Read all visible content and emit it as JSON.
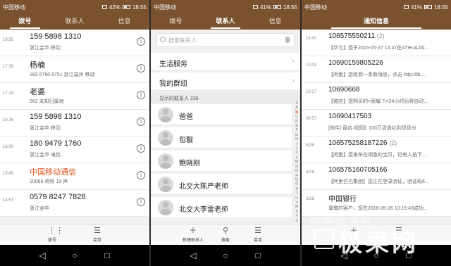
{
  "status": {
    "carrier": "中国移动",
    "battery1": "42%",
    "battery2": "41%",
    "battery3": "41%",
    "time": "18:55"
  },
  "dialer": {
    "tabs": [
      "拨号",
      "联系人",
      "信息"
    ],
    "calls": [
      {
        "time": "18:55",
        "number": "159 5898 1310",
        "sub": "浙江金华 移动",
        "missed": false
      },
      {
        "time": "17:36",
        "number": "杨楠",
        "sub": "183 6780 8751  浙江温州 移动",
        "missed": false
      },
      {
        "time": "17:18",
        "number": "老婆",
        "sub": "662  未知归属地",
        "missed": false
      },
      {
        "time": "16:16",
        "number": "159 5898 1310",
        "sub": "浙江金华 移动",
        "missed": false
      },
      {
        "time": "16:09",
        "number": "180 9479 1760",
        "sub": "浙江金华 电信",
        "missed": false
      },
      {
        "time": "15:45",
        "number": "中国移动通信",
        "sub": "10086  响铃 19 声",
        "missed": true
      },
      {
        "time": "14:57",
        "number": "0579 8247 7828",
        "sub": "浙江金华",
        "missed": false
      }
    ],
    "tools": [
      {
        "label": "拨号"
      },
      {
        "label": "菜单"
      }
    ]
  },
  "contacts": {
    "tabs": [
      "拨号",
      "联系人",
      "信息"
    ],
    "search_placeholder": "搜索联系人",
    "groups": [
      "生活服务",
      "我的群组"
    ],
    "section_label": "显示的联系人 236",
    "names": [
      "爸爸",
      "包靓",
      "鲍晓刚",
      "北交大陈严老师",
      "北交大李雷老师"
    ],
    "alphabet": [
      "#",
      "A",
      "B",
      "C",
      "D",
      "E",
      "F",
      "G",
      "H",
      "I",
      "J",
      "K",
      "L",
      "M",
      "N",
      "O",
      "P",
      "Q",
      "R",
      "S",
      "T",
      "U",
      "V",
      "W",
      "X",
      "Y",
      "Z"
    ],
    "tools": [
      {
        "label": "新建联系人"
      },
      {
        "label": "搜索"
      },
      {
        "label": "菜单"
      }
    ]
  },
  "messages": {
    "title": "通知信息",
    "items": [
      {
        "time": "14:47",
        "sender": "106575550211",
        "count": "(2)",
        "preview": "【华为】您于2016-05-27 14:47在ATH-AL00..."
      },
      {
        "time": "13:01",
        "sender": "10690159805226",
        "count": "",
        "preview": "【闲鱼】您收到一条新消息，点击 http://tb...."
      },
      {
        "time": "10:27",
        "sender": "10690668",
        "count": "",
        "preview": "【微店】您购买的<荣耀 7i>24小时后将自动..."
      },
      {
        "time": "09:57",
        "sender": "10690417503",
        "count": "",
        "preview": "[附件] 竟达·视园】100万清盘红利现场分"
      },
      {
        "time": "5/26",
        "sender": "106575258187226",
        "count": "(2)",
        "preview": "【闲鱼】您发布在闲鱼的宝贝，已有人拍下..."
      },
      {
        "time": "5/26",
        "sender": "106575160705166",
        "count": "",
        "preview": "【阿里巴巴集团】您正在登录验证，验证码6..."
      },
      {
        "time": "5/26",
        "sender": "中国银行",
        "count": "",
        "preview": "尊敬的客户，您在2016-05-26 10:15:43成功..."
      }
    ]
  },
  "watermark": {
    "line1": "微信公众号",
    "brand": "极果网"
  }
}
